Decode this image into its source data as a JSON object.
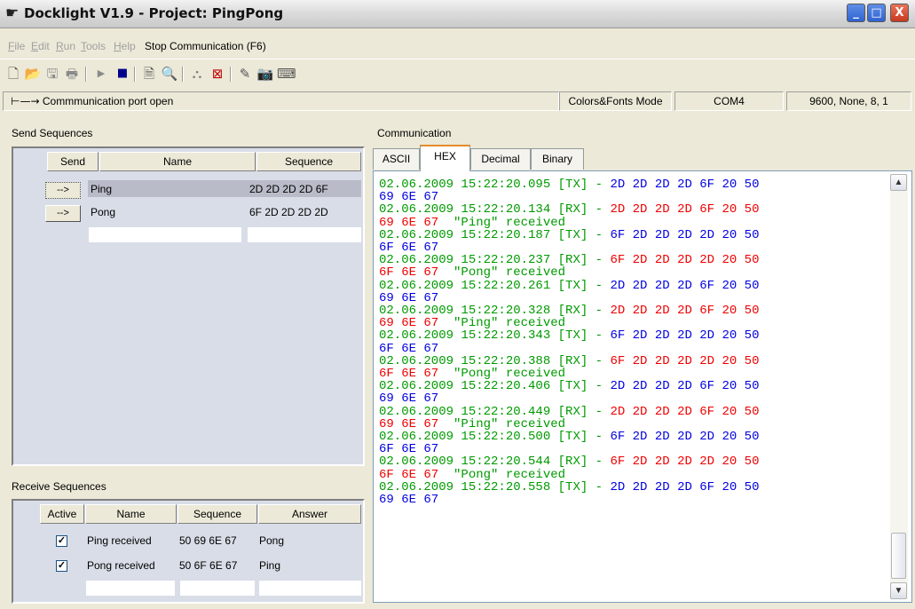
{
  "window": {
    "title": "Docklight V1.9 - Project: PingPong"
  },
  "menu": {
    "items": [
      {
        "label": "File"
      },
      {
        "label": "Edit"
      },
      {
        "label": "Run"
      },
      {
        "label": "Tools"
      },
      {
        "label": "Help"
      }
    ],
    "stop_label": "Stop Communication  (F6)"
  },
  "toolbar": {
    "icons": [
      "new-file-icon",
      "open-folder-icon",
      "save-icon",
      "print-icon",
      "play-icon",
      "stop-icon",
      "properties-icon",
      "search-icon",
      "binoculars-icon",
      "clear-icon",
      "notepad-icon",
      "camera-icon",
      "keyboard-icon"
    ]
  },
  "status": {
    "message": "Commmunication port open",
    "mode": "Colors&Fonts Mode",
    "port": "COM4",
    "settings": "9600, None, 8, 1"
  },
  "send": {
    "title": "Send Sequences",
    "headers": {
      "send": "Send",
      "name": "Name",
      "sequence": "Sequence"
    },
    "rows": [
      {
        "button": "-->",
        "name": "Ping",
        "sequence": "2D 2D 2D 2D 6F"
      },
      {
        "button": "-->",
        "name": "Pong",
        "sequence": "6F 2D 2D 2D 2D"
      }
    ]
  },
  "receive": {
    "title": "Receive Sequences",
    "headers": {
      "active": "Active",
      "name": "Name",
      "sequence": "Sequence",
      "answer": "Answer"
    },
    "rows": [
      {
        "active": true,
        "name": "Ping received",
        "sequence": "50 69 6E 67",
        "answer": "Pong"
      },
      {
        "active": true,
        "name": "Pong received",
        "sequence": "50 6F 6E 67",
        "answer": "Ping"
      }
    ]
  },
  "communication": {
    "title": "Communication",
    "tabs": [
      {
        "label": "ASCII"
      },
      {
        "label": "HEX"
      },
      {
        "label": "Decimal"
      },
      {
        "label": "Binary"
      }
    ],
    "active_tab": "HEX",
    "log": [
      {
        "ts": "02.06.2009 15:22:20.095",
        "dir": "[TX]",
        "bytes": "2D 2D 2D 2D 6F 20 50",
        "cont": "69 6E 67",
        "note": ""
      },
      {
        "ts": "02.06.2009 15:22:20.134",
        "dir": "[RX]",
        "bytes": "2D 2D 2D 2D 6F 20 50",
        "cont": "69 6E 67",
        "note": "\"Ping\" received"
      },
      {
        "ts": "02.06.2009 15:22:20.187",
        "dir": "[TX]",
        "bytes": "6F 2D 2D 2D 2D 20 50",
        "cont": "6F 6E 67",
        "note": ""
      },
      {
        "ts": "02.06.2009 15:22:20.237",
        "dir": "[RX]",
        "bytes": "6F 2D 2D 2D 2D 20 50",
        "cont": "6F 6E 67",
        "note": "\"Pong\" received"
      },
      {
        "ts": "02.06.2009 15:22:20.261",
        "dir": "[TX]",
        "bytes": "2D 2D 2D 2D 6F 20 50",
        "cont": "69 6E 67",
        "note": ""
      },
      {
        "ts": "02.06.2009 15:22:20.328",
        "dir": "[RX]",
        "bytes": "2D 2D 2D 2D 6F 20 50",
        "cont": "69 6E 67",
        "note": "\"Ping\" received"
      },
      {
        "ts": "02.06.2009 15:22:20.343",
        "dir": "[TX]",
        "bytes": "6F 2D 2D 2D 2D 20 50",
        "cont": "6F 6E 67",
        "note": ""
      },
      {
        "ts": "02.06.2009 15:22:20.388",
        "dir": "[RX]",
        "bytes": "6F 2D 2D 2D 2D 20 50",
        "cont": "6F 6E 67",
        "note": "\"Pong\" received"
      },
      {
        "ts": "02.06.2009 15:22:20.406",
        "dir": "[TX]",
        "bytes": "2D 2D 2D 2D 6F 20 50",
        "cont": "69 6E 67",
        "note": ""
      },
      {
        "ts": "02.06.2009 15:22:20.449",
        "dir": "[RX]",
        "bytes": "2D 2D 2D 2D 6F 20 50",
        "cont": "69 6E 67",
        "note": "\"Ping\" received"
      },
      {
        "ts": "02.06.2009 15:22:20.500",
        "dir": "[TX]",
        "bytes": "6F 2D 2D 2D 2D 20 50",
        "cont": "6F 6E 67",
        "note": ""
      },
      {
        "ts": "02.06.2009 15:22:20.544",
        "dir": "[RX]",
        "bytes": "6F 2D 2D 2D 2D 20 50",
        "cont": "6F 6E 67",
        "note": "\"Pong\" received"
      },
      {
        "ts": "02.06.2009 15:22:20.558",
        "dir": "[TX]",
        "bytes": "2D 2D 2D 2D 6F 20 50",
        "cont": "69 6E 67",
        "note": ""
      }
    ],
    "colors": {
      "tx": "#0000e0",
      "rx": "#ee0000",
      "meta": "#009a00"
    }
  }
}
